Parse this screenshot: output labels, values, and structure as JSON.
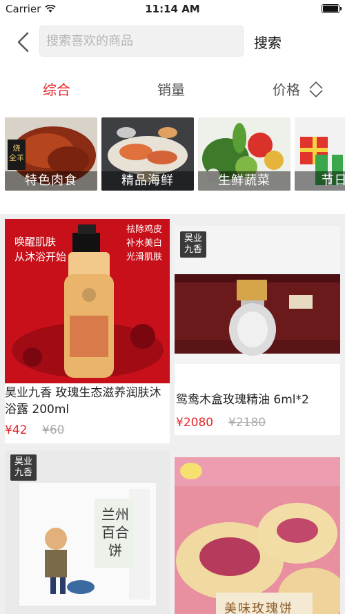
{
  "status_bar": {
    "carrier": "Carrier",
    "time": "11:14 AM",
    "icons": [
      "wifi-icon",
      "battery-icon"
    ]
  },
  "header": {
    "back_icon": "chevron-left-icon",
    "search_placeholder": "搜索喜欢的商品",
    "search_value": "",
    "search_button": "搜索"
  },
  "sort_tabs": [
    {
      "label": "综合",
      "active": true
    },
    {
      "label": "销量",
      "active": false
    },
    {
      "label": "价格",
      "active": false,
      "icon": "sort-updown-icon"
    }
  ],
  "categories": [
    {
      "label": "特色肉食"
    },
    {
      "label": "精品海鲜"
    },
    {
      "label": "生鲜蔬菜"
    },
    {
      "label": "节日五"
    }
  ],
  "products": [
    {
      "title": "昊业九香 玫瑰生态滋养润肤沐浴露 200ml",
      "price": "¥42",
      "old_price": "¥60",
      "badge": "",
      "promo_lines": [
        "唤醒肌肤",
        "从沐浴开始",
        "祛除鸡皮",
        "补水美白",
        "光滑肌肤"
      ]
    },
    {
      "title": "鸳鸯木盒玫瑰精油 6ml*2",
      "price": "¥2080",
      "old_price": "¥2180",
      "badge": "昊业九香"
    },
    {
      "title": "",
      "price": "",
      "old_price": "",
      "badge": "昊业九香",
      "image_text": "兰州 百合饼"
    },
    {
      "title": "",
      "price": "",
      "old_price": "",
      "badge": "",
      "image_text": "美味玫瑰饼"
    }
  ],
  "colors": {
    "accent": "#e5262b",
    "muted": "#aaaaaa",
    "background": "#efefef"
  }
}
